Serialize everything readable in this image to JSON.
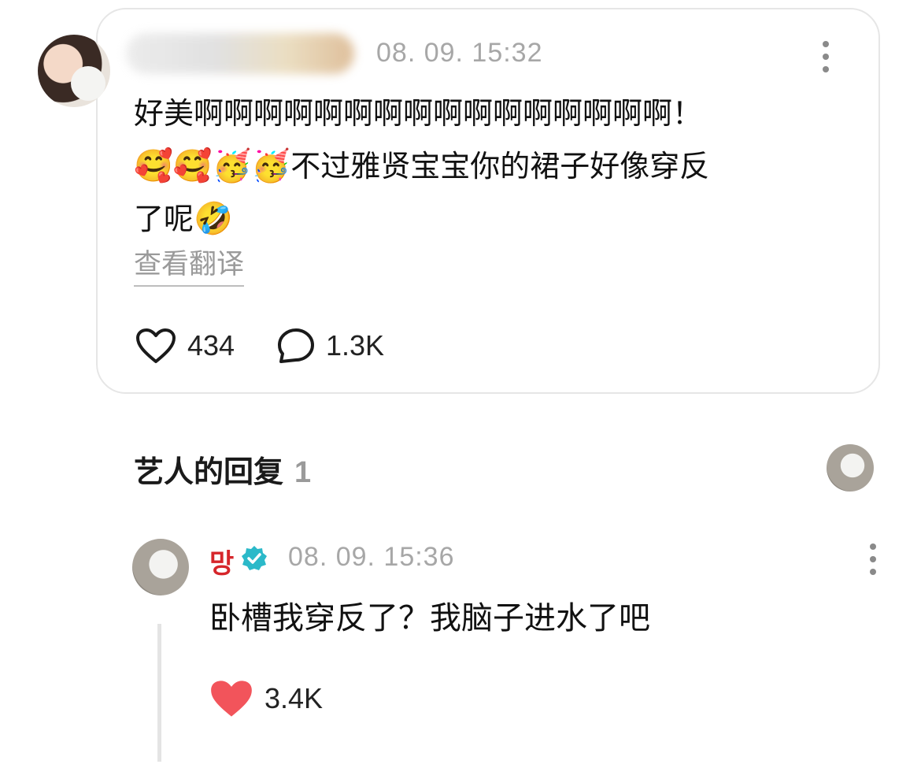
{
  "comment": {
    "time": "08. 09. 15:32",
    "text_line1": "好美啊啊啊啊啊啊啊啊啊啊啊啊啊啊啊啊！",
    "emoji_row": "🥰🥰🥳🥳",
    "text_line2": "不过雅贤宝宝你的裙子好像穿反",
    "text_line3": "了呢",
    "emoji_end": "🤣",
    "translate_label": "查看翻译",
    "likes": "434",
    "replies": "1.3K"
  },
  "artist_section": {
    "title": "艺人的回复",
    "count": "1"
  },
  "reply": {
    "name": "망",
    "time": "08. 09. 15:36",
    "text": "卧槽我穿反了？我脑子进水了吧",
    "likes": "3.4K"
  },
  "icons": {
    "like": "heart-outline-icon",
    "reply": "speech-bubble-icon",
    "liked": "heart-filled-icon",
    "verified": "verified-badge-icon",
    "more": "more-vertical-icon"
  },
  "colors": {
    "liked_heart": "#f2545b",
    "artist_name": "#d6262b",
    "verified_badge": "#2bb9c9",
    "muted_text": "#a7a7a7"
  }
}
